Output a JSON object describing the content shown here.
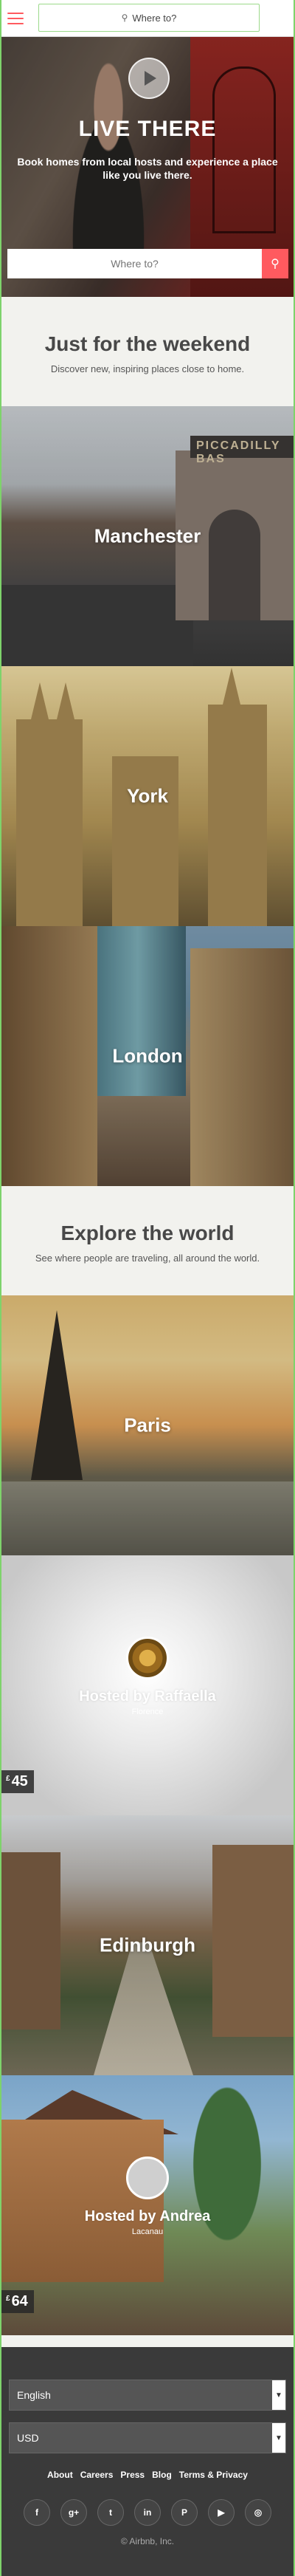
{
  "header": {
    "search_label": "Where to?"
  },
  "hero": {
    "title": "LIVE THERE",
    "subtitle": "Book homes from local hosts and experience a place like you live there.",
    "search_placeholder": "Where to?"
  },
  "weekend": {
    "title": "Just for the weekend",
    "subtitle": "Discover new, inspiring places close to home.",
    "tiles": [
      {
        "label": "Manchester",
        "sign": "PICCADILLY BAS"
      },
      {
        "label": "York"
      },
      {
        "label": "London"
      }
    ]
  },
  "explore": {
    "title": "Explore the world",
    "subtitle": "See where people are traveling, all around the world.",
    "paris": "Paris",
    "host1": {
      "name": "Hosted by Raffaella",
      "city": "Florence",
      "currency": "£",
      "price": "45"
    },
    "edinburgh": "Edinburgh",
    "host2": {
      "name": "Hosted by Andrea",
      "city": "Lacanau",
      "currency": "£",
      "price": "64"
    }
  },
  "footer": {
    "language": "English",
    "currency": "USD",
    "links": [
      "About",
      "Careers",
      "Press",
      "Blog",
      "Terms & Privacy"
    ],
    "socials": [
      {
        "icon": "facebook-icon",
        "glyph": "f"
      },
      {
        "icon": "google-plus-icon",
        "glyph": "g+"
      },
      {
        "icon": "twitter-icon",
        "glyph": "t"
      },
      {
        "icon": "linkedin-icon",
        "glyph": "in"
      },
      {
        "icon": "pinterest-icon",
        "glyph": "P"
      },
      {
        "icon": "youtube-icon",
        "glyph": "▶"
      },
      {
        "icon": "instagram-icon",
        "glyph": "◎"
      }
    ],
    "copyright": "© Airbnb, Inc."
  },
  "colors": {
    "accent": "#ff5a5f",
    "footer_bg": "#3a3a3a"
  }
}
